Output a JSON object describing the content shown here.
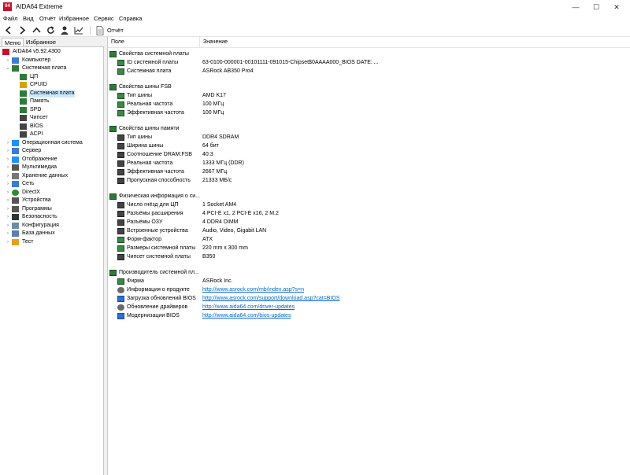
{
  "window": {
    "title": "AIDA64 Extreme",
    "logo": "64",
    "min": "—",
    "max": "☐",
    "close": "✕"
  },
  "menu": [
    "Файл",
    "Вид",
    "Отчёт",
    "Избранное",
    "Сервис",
    "Справка"
  ],
  "toolbar": {
    "report_label": "Отчёт",
    "icons": [
      "back-icon",
      "forward-icon",
      "up-icon",
      "refresh-icon",
      "user-icon",
      "chart-icon",
      "report-icon"
    ]
  },
  "tabs": [
    "Меню",
    "Избранное"
  ],
  "tree": [
    {
      "label": "AIDA64 v5.92.4300",
      "level": 0,
      "arrow": "",
      "icon": "aida-logo-icon"
    },
    {
      "label": "Компьютер",
      "level": 1,
      "arrow": "›",
      "icon": "computer-icon"
    },
    {
      "label": "Системная плата",
      "level": 1,
      "arrow": "⌄",
      "icon": "motherboard-icon"
    },
    {
      "label": "ЦП",
      "level": 2,
      "arrow": "",
      "icon": "cpu-icon"
    },
    {
      "label": "CPUID",
      "level": 2,
      "arrow": "",
      "icon": "cpuid-icon"
    },
    {
      "label": "Системная плата",
      "level": 2,
      "arrow": "",
      "icon": "motherboard-icon",
      "selected": true
    },
    {
      "label": "Память",
      "level": 2,
      "arrow": "",
      "icon": "memory-icon"
    },
    {
      "label": "SPD",
      "level": 2,
      "arrow": "",
      "icon": "spd-icon"
    },
    {
      "label": "Чипсет",
      "level": 2,
      "arrow": "",
      "icon": "chipset-icon"
    },
    {
      "label": "BIOS",
      "level": 2,
      "arrow": "",
      "icon": "bios-icon"
    },
    {
      "label": "ACPI",
      "level": 2,
      "arrow": "",
      "icon": "acpi-icon"
    },
    {
      "label": "Операционная система",
      "level": 1,
      "arrow": "›",
      "icon": "windows-icon"
    },
    {
      "label": "Сервер",
      "level": 1,
      "arrow": "›",
      "icon": "server-icon"
    },
    {
      "label": "Отображение",
      "level": 1,
      "arrow": "›",
      "icon": "display-icon"
    },
    {
      "label": "Мультимедиа",
      "level": 1,
      "arrow": "›",
      "icon": "multimedia-icon"
    },
    {
      "label": "Хранение данных",
      "level": 1,
      "arrow": "›",
      "icon": "storage-icon"
    },
    {
      "label": "Сеть",
      "level": 1,
      "arrow": "›",
      "icon": "network-icon"
    },
    {
      "label": "DirectX",
      "level": 1,
      "arrow": "›",
      "icon": "directx-icon"
    },
    {
      "label": "Устройства",
      "level": 1,
      "arrow": "›",
      "icon": "devices-icon"
    },
    {
      "label": "Программы",
      "level": 1,
      "arrow": "›",
      "icon": "programs-icon"
    },
    {
      "label": "Безопасность",
      "level": 1,
      "arrow": "›",
      "icon": "security-icon"
    },
    {
      "label": "Конфигурация",
      "level": 1,
      "arrow": "›",
      "icon": "config-icon"
    },
    {
      "label": "База данных",
      "level": 1,
      "arrow": "›",
      "icon": "database-icon"
    },
    {
      "label": "Тест",
      "level": 1,
      "arrow": "›",
      "icon": "test-icon"
    }
  ],
  "columns": {
    "field": "Поле",
    "value": "Значение"
  },
  "sections": [
    {
      "title": "Свойства системной платы",
      "rows": [
        {
          "name": "ID системной платы",
          "value": "63-0100-000001-00101111-091015-Chipset$0AAAA000_BIOS DATE: ...",
          "icon": "leaf"
        },
        {
          "name": "Системная плата",
          "value": "ASRock AB350 Pro4",
          "icon": "leaf"
        }
      ]
    },
    {
      "title": "Свойства шины FSB",
      "rows": [
        {
          "name": "Тип шины",
          "value": "AMD K17",
          "icon": "leaf"
        },
        {
          "name": "Реальная частота",
          "value": "100 МГц",
          "icon": "leaf"
        },
        {
          "name": "Эффективная частота",
          "value": "100 МГц",
          "icon": "leaf"
        }
      ]
    },
    {
      "title": "Свойства шины памяти",
      "rows": [
        {
          "name": "Тип шины",
          "value": "DDR4 SDRAM",
          "icon": "chip"
        },
        {
          "name": "Ширина шины",
          "value": "64 бит",
          "icon": "chip"
        },
        {
          "name": "Соотношение DRAM:FSB",
          "value": "40:3",
          "icon": "chip"
        },
        {
          "name": "Реальная частота",
          "value": "1333 МГц (DDR)",
          "icon": "chip"
        },
        {
          "name": "Эффективная частота",
          "value": "2667 МГц",
          "icon": "chip"
        },
        {
          "name": "Пропускная способность",
          "value": "21333 МБ/с",
          "icon": "chip"
        }
      ]
    },
    {
      "title": "Физическая информация о си...",
      "rows": [
        {
          "name": "Число гнёзд для ЦП",
          "value": "1 Socket AM4",
          "icon": "chip"
        },
        {
          "name": "Разъёмы расширения",
          "value": "4 PCI-E x1, 2 PCI-E x16, 2 M.2",
          "icon": "chip"
        },
        {
          "name": "Разъёмы ОЗУ",
          "value": "4 DDR4 DIMM",
          "icon": "chip"
        },
        {
          "name": "Встроенные устройства",
          "value": "Audio, Video, Gigabit LAN",
          "icon": "chip"
        },
        {
          "name": "Форм-фактор",
          "value": "ATX",
          "icon": "leaf"
        },
        {
          "name": "Размеры системной платы",
          "value": "220 mm x 300 mm",
          "icon": "leaf"
        },
        {
          "name": "Чипсет системной платы",
          "value": "B350",
          "icon": "chip"
        }
      ]
    },
    {
      "title": "Производитель системной пл...",
      "rows": [
        {
          "name": "Фирма",
          "value": "ASRock Inc.",
          "icon": "leaf"
        },
        {
          "name": "Информация о продукте",
          "value": "http://www.asrock.com/mb/index.asp?s=n",
          "icon": "info",
          "link": true
        },
        {
          "name": "Загрузка обновлений BIOS",
          "value": "http://www.asrock.com/support/download.asp?cat=BIOS",
          "icon": "bios",
          "link": true
        },
        {
          "name": "Обновление драйверов",
          "value": "http://www.aida64.com/driver-updates",
          "icon": "info",
          "link": true
        },
        {
          "name": "Модернизации BIOS",
          "value": "http://www.aida64.com/bios-updates",
          "icon": "bios",
          "link": true
        }
      ]
    }
  ]
}
